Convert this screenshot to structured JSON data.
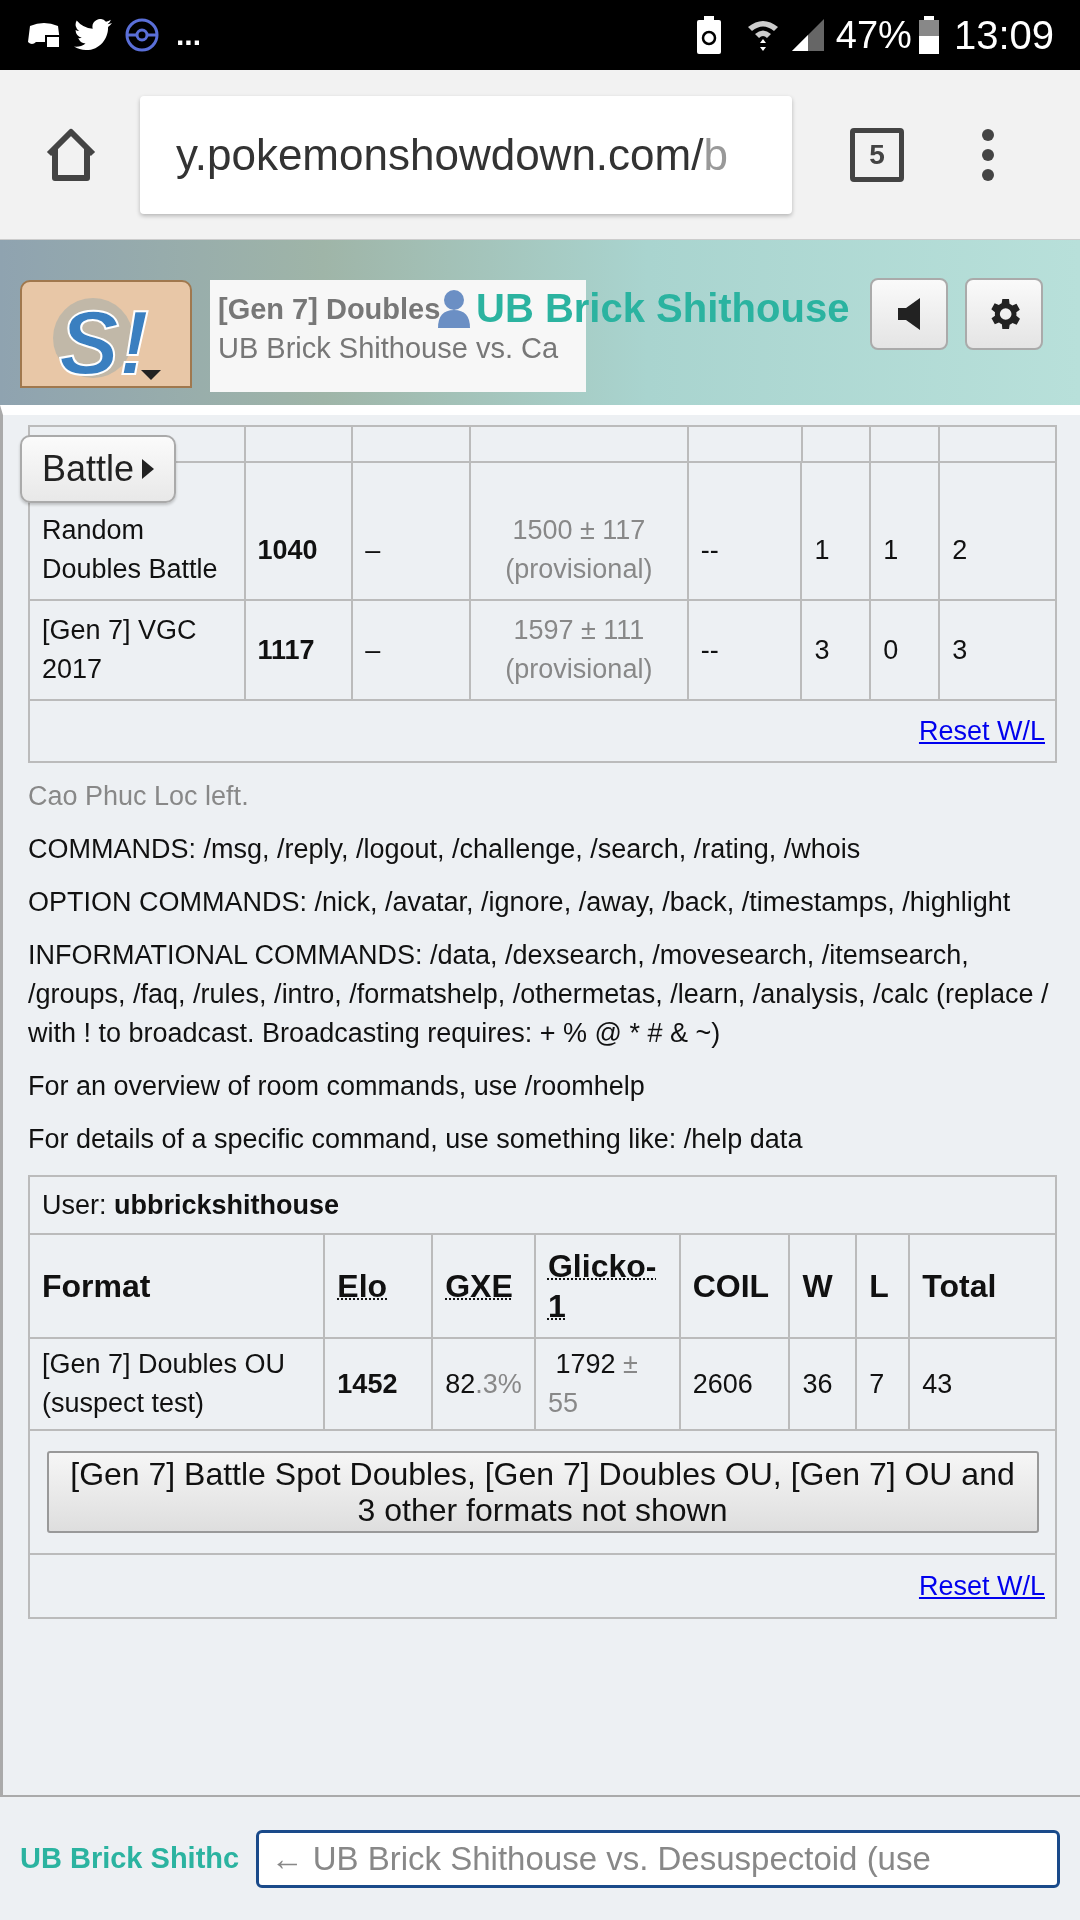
{
  "status_bar": {
    "more": "...",
    "battery": "47%",
    "time": "13:09"
  },
  "browser": {
    "url_main": "y.pokemonshowdown.com/",
    "url_tail": "b",
    "tab_count": "5"
  },
  "header": {
    "logo_text": "S!",
    "tab_title": "[Gen 7] Doubles",
    "tab_subtitle": "UB Brick Shithouse vs. Ca",
    "username": "UB Brick Shithouse"
  },
  "battle_button": {
    "label": "Battle"
  },
  "top_table": {
    "rows": [
      {
        "format": "Random Doubles Battle",
        "elo": "1040",
        "gxe": "–",
        "glicko": "1500 ± 117 (provisional)",
        "coil": "--",
        "w": "1",
        "l": "1",
        "total": "2"
      },
      {
        "format": "[Gen 7] VGC 2017",
        "elo": "1117",
        "gxe": "–",
        "glicko": "1597 ± 111 (provisional)",
        "coil": "--",
        "w": "3",
        "l": "0",
        "total": "3"
      }
    ],
    "reset_link": "Reset W/L"
  },
  "messages": [
    {
      "kind": "notice",
      "text": "Cao Phuc Loc left."
    },
    {
      "kind": "plain",
      "text": "COMMANDS: /msg, /reply, /logout, /challenge, /search, /rating, /whois"
    },
    {
      "kind": "plain",
      "text": "OPTION COMMANDS: /nick, /avatar, /ignore, /away, /back, /timestamps, /highlight"
    },
    {
      "kind": "plain",
      "text": "INFORMATIONAL COMMANDS: /data, /dexsearch, /movesearch, /itemsearch, /groups, /faq, /rules, /intro, /formatshelp, /othermetas, /learn, /analysis, /calc (replace / with ! to broadcast. Broadcasting requires: + % @ * # & ~)"
    },
    {
      "kind": "plain",
      "text": "For an overview of room commands, use /roomhelp"
    },
    {
      "kind": "plain",
      "text": "For details of a specific command, use something like: /help data"
    }
  ],
  "user_table": {
    "user_label": "User:",
    "user_name": "ubbrickshithouse",
    "columns": [
      {
        "label": "Format",
        "abbr": false
      },
      {
        "label": "Elo",
        "abbr": true
      },
      {
        "label": "GXE",
        "abbr": true
      },
      {
        "label": "Glicko-1",
        "abbr": true
      },
      {
        "label": "COIL",
        "abbr": false
      },
      {
        "label": "W",
        "abbr": false
      },
      {
        "label": "L",
        "abbr": false
      },
      {
        "label": "Total",
        "abbr": false
      }
    ],
    "rows": [
      {
        "format": "[Gen 7] Doubles OU (suspect test)",
        "elo": "1452",
        "gxe_main": "82",
        "gxe_minor": ".3%",
        "glicko_main": "1792",
        "glicko_minor": "± 55",
        "coil": "2606",
        "w": "36",
        "l": "7",
        "total": "43"
      }
    ],
    "more_button": "[Gen 7] Battle Spot Doubles, [Gen 7] Doubles OU, [Gen 7] OU and 3 other formats not shown",
    "reset_link": "Reset W/L"
  },
  "chat_input": {
    "name": "UB Brick Shithc",
    "placeholder": "← UB Brick Shithouse vs. Desuspectoid (use"
  }
}
